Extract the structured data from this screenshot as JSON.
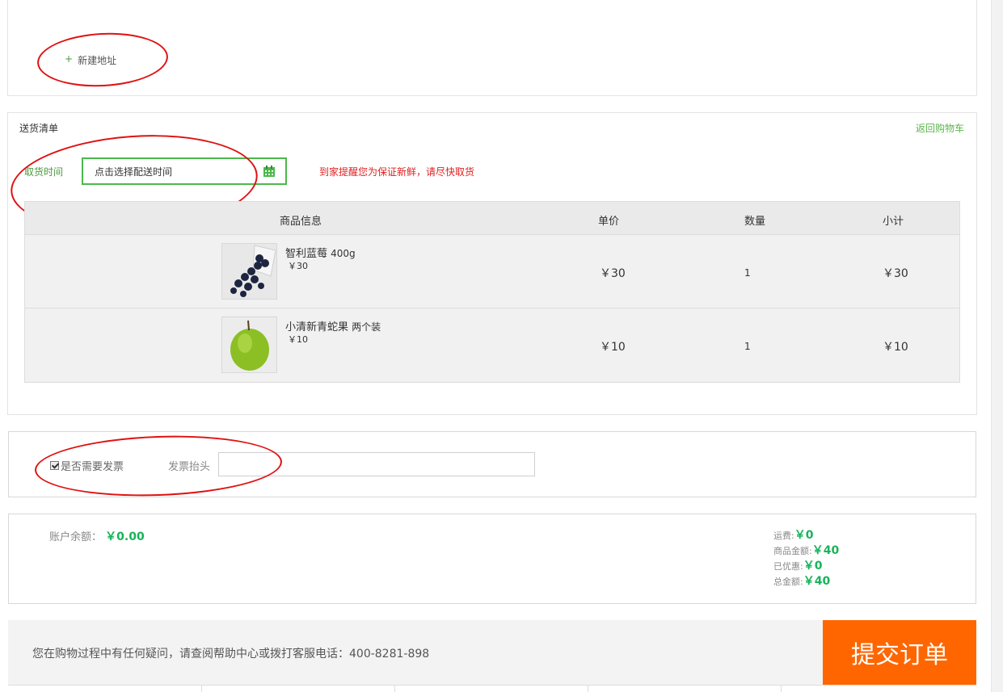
{
  "address": {
    "plus": "+",
    "new_label": "新建地址"
  },
  "delivery": {
    "title": "送货清单",
    "back_to_cart": "返回购物车",
    "pickup_label": "取货时间",
    "pickup_placeholder": "点击选择配送时间",
    "reminder": "到家提醒您为保证新鲜，请尽快取货"
  },
  "table": {
    "headers": {
      "info": "商品信息",
      "unit_price": "单价",
      "qty": "数量",
      "subtotal": "小计"
    },
    "rows": [
      {
        "name": "智利蓝莓",
        "spec": "400g",
        "price_small": "￥30",
        "unit_price": "￥30",
        "qty": "1",
        "subtotal": "￥30",
        "image": "blueberry-image"
      },
      {
        "name": "小清新青蛇果",
        "spec": "两个装",
        "price_small": "￥10",
        "unit_price": "￥10",
        "qty": "1",
        "subtotal": "￥10",
        "image": "green-apple-image"
      }
    ]
  },
  "invoice": {
    "need_label": "是否需要发票",
    "checked": true,
    "title_label": "发票抬头",
    "title_value": ""
  },
  "summary": {
    "balance_label": "账户余额：",
    "balance_value": "￥0.00",
    "shipping_label": "运费:",
    "shipping_value": "￥0",
    "goods_label": "商品金额:",
    "goods_value": "￥40",
    "discount_label": "已优惠:",
    "discount_value": "￥0",
    "total_label": "总金额:",
    "total_value": "￥40"
  },
  "footer": {
    "note": "您在购物过程中有任何疑问，请查阅帮助中心或拨打客服电话：400-8281-898",
    "submit": "提交订单"
  },
  "colors": {
    "green": "#4bb84a",
    "amount_green": "#17b35a",
    "orange": "#ff6600",
    "red": "#e01010"
  }
}
